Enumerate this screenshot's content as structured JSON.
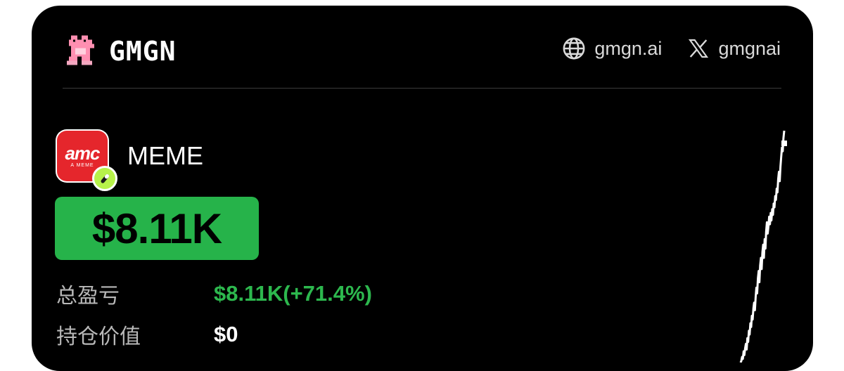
{
  "brand": {
    "name": "GMGN",
    "logo_icon": "pixel-frog-icon"
  },
  "links": [
    {
      "icon": "globe-icon",
      "label": "gmgn.ai"
    },
    {
      "icon": "x-logo-icon",
      "label": "gmgnai"
    }
  ],
  "token": {
    "name": "MEME",
    "logo_text": "amc",
    "logo_subtext": "A MEME",
    "badge_icon": "pump-pill-icon"
  },
  "pnl": {
    "value": "$8.11K",
    "color": "#26b34a"
  },
  "stats": [
    {
      "label": "总盈亏",
      "value": "$8.11K(+71.4%)"
    },
    {
      "label": "持仓价值",
      "value": "$0"
    }
  ],
  "colors": {
    "background": "#000000",
    "accent_green": "#2db84e",
    "text": "#ffffff"
  },
  "chart_data": {
    "type": "line",
    "title": "",
    "xlabel": "",
    "ylabel": "",
    "grid": false,
    "legend": "none",
    "series": [
      {
        "values": [
          0,
          2,
          6,
          4,
          12,
          8,
          15,
          20,
          14,
          26,
          22,
          34,
          30,
          42,
          38,
          50,
          46,
          58,
          64,
          56,
          70,
          80,
          74,
          90,
          98,
          86,
          104,
          112,
          100,
          118,
          126,
          112,
          132,
          122,
          140,
          150,
          138,
          146,
          156,
          148,
          160,
          152,
          164,
          158,
          170,
          166,
          178,
          174,
          186,
          182,
          196,
          204,
          194,
          210,
          220,
          230,
          226,
          240,
          248
        ]
      }
    ]
  }
}
